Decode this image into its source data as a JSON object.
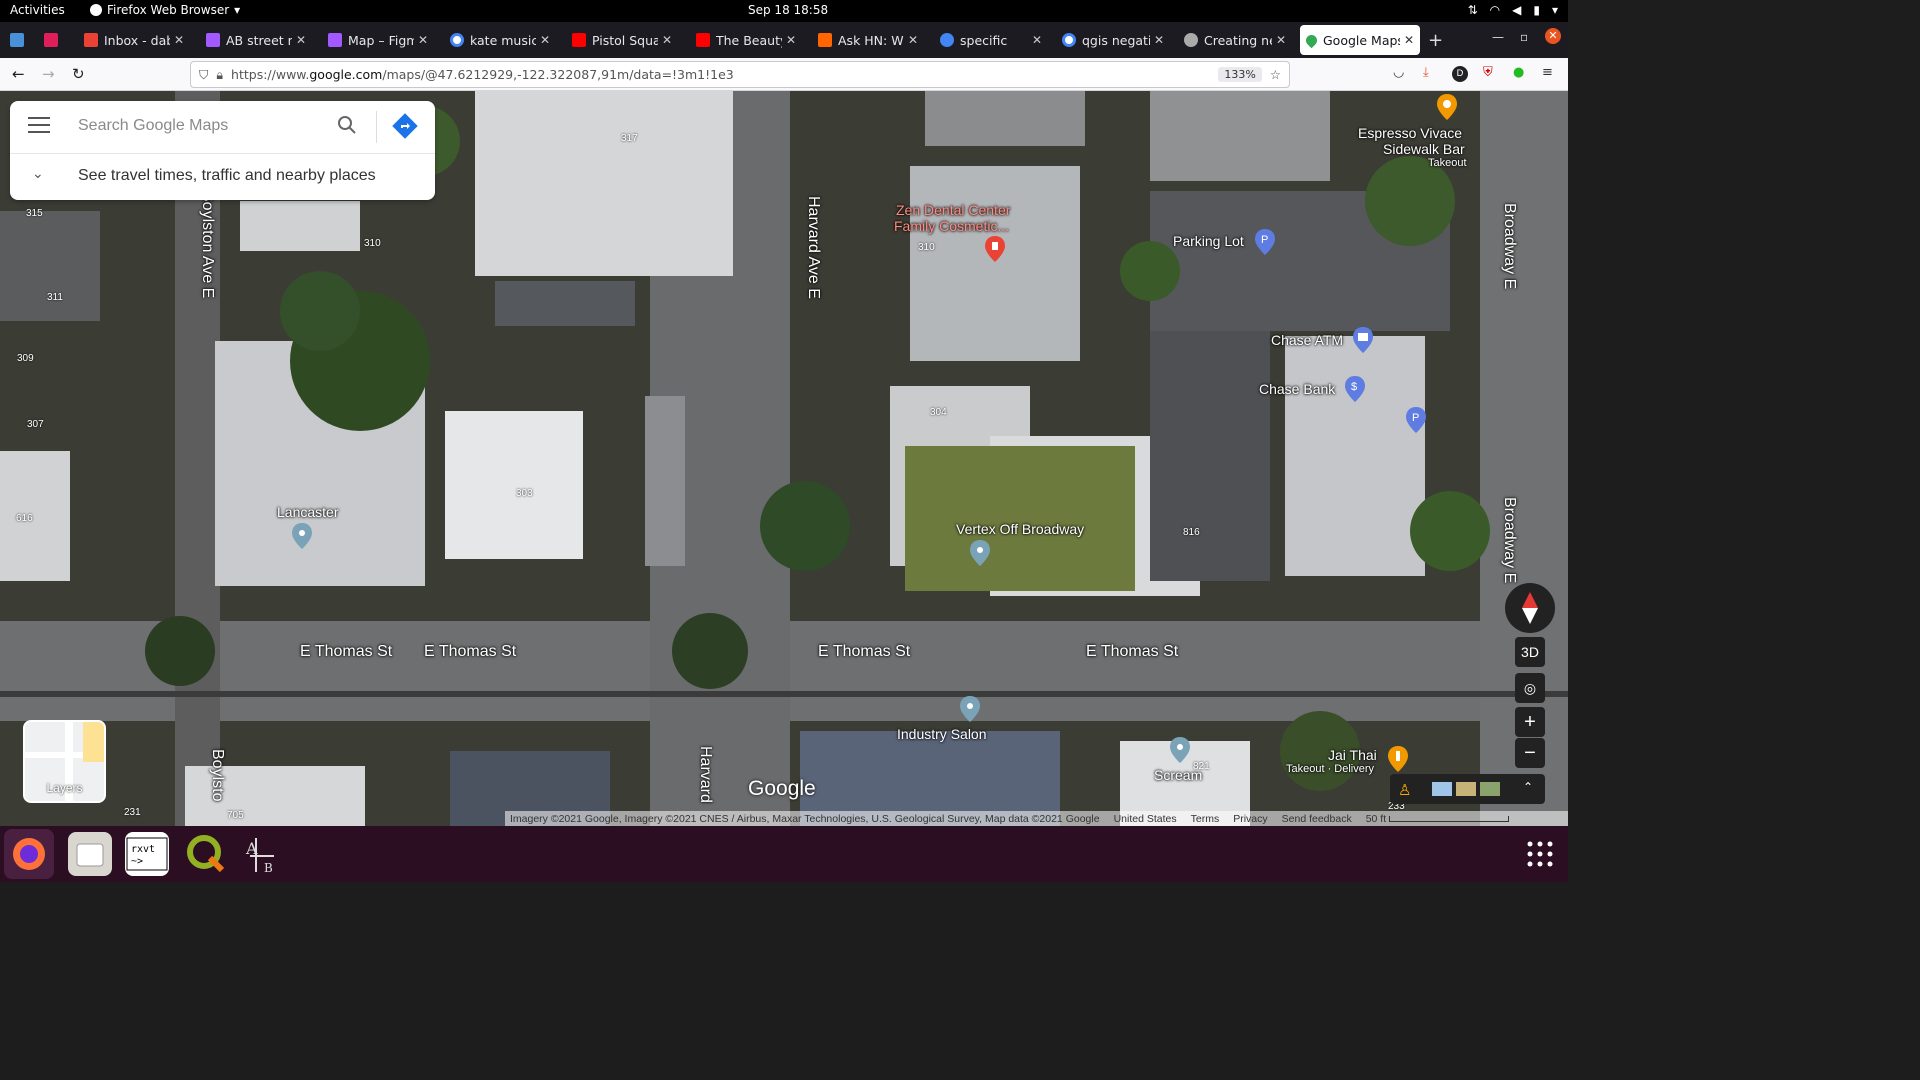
{
  "topbar": {
    "activities": "Activities",
    "app_menu": "Firefox Web Browser",
    "clock": "Sep 18  18:58"
  },
  "tabs": [
    {
      "label": "",
      "color": "#4a90d9"
    },
    {
      "label": "",
      "color": "#e01e5a"
    },
    {
      "label": "Inbox - dabrec",
      "color": "#ea4335"
    },
    {
      "label": "AB street mo",
      "color": "#a259ff"
    },
    {
      "label": "Map – Figma",
      "color": "#a259ff"
    },
    {
      "label": "kate music - G",
      "color": "#4285f4"
    },
    {
      "label": "Pistol Squats",
      "color": "#ff0000"
    },
    {
      "label": "The Beauty of",
      "color": "#ff0000"
    },
    {
      "label": "Ask HN: Wher",
      "color": "#ff6600"
    },
    {
      "label": "specific",
      "color": "#4285f4"
    },
    {
      "label": "qgis negative",
      "color": "#4285f4"
    },
    {
      "label": "Creating new",
      "color": "#aaaaaa"
    },
    {
      "label": "Google Maps",
      "color": "#34a853",
      "active": true
    }
  ],
  "navbar": {
    "url_prefix": "https://www.",
    "url_domain": "google.com",
    "url_path": "/maps/@47.6212929,-122.322087,91m/data=!3m1!1e3",
    "zoom": "133%"
  },
  "search": {
    "placeholder": "Search Google Maps",
    "travel": "See travel times, traffic and nearby places"
  },
  "pois": {
    "espresso": "Espresso Vivace",
    "espresso2": "Sidewalk Bar",
    "espresso3": "Takeout",
    "zen": "Zen Dental Center",
    "zen2": "Family Cosmetic...",
    "parking": "Parking Lot",
    "chase_atm": "Chase ATM",
    "chase_bank": "Chase Bank",
    "lancaster": "Lancaster",
    "vertex": "Vertex Off Broadway",
    "industry": "Industry Salon",
    "scream": "Scream",
    "jai_thai": "Jai Thai",
    "jai_thai2": "Takeout · Delivery"
  },
  "addresses": [
    "317",
    "315",
    "310",
    "311",
    "309",
    "307",
    "616",
    "310",
    "304",
    "303",
    "816",
    "231",
    "705",
    "821",
    "233"
  ],
  "streets": {
    "thomas1": "E Thomas St",
    "thomas2": "E Thomas St",
    "thomas3": "E Thomas St",
    "thomas4": "E Thomas St",
    "boylston": "Boylston Ave E",
    "boylston2": "Boylsto",
    "harvard": "Harvard Ave E",
    "harvard2": "Harvard",
    "broadway": "Broadway E",
    "broadway2": "Broadway E"
  },
  "controls": {
    "layers": "Layers",
    "three_d": "3D",
    "zoom_in": "+",
    "zoom_out": "−"
  },
  "logo": "Google",
  "attribution": {
    "imagery": "Imagery ©2021 Google, Imagery ©2021 CNES / Airbus, Maxar Technologies, U.S. Geological Survey, Map data ©2021 Google",
    "country": "United States",
    "terms": "Terms",
    "privacy": "Privacy",
    "feedback": "Send feedback",
    "scale": "50 ft"
  },
  "colors": {
    "accent": "#e95420",
    "map_dark": "#3e4038"
  }
}
